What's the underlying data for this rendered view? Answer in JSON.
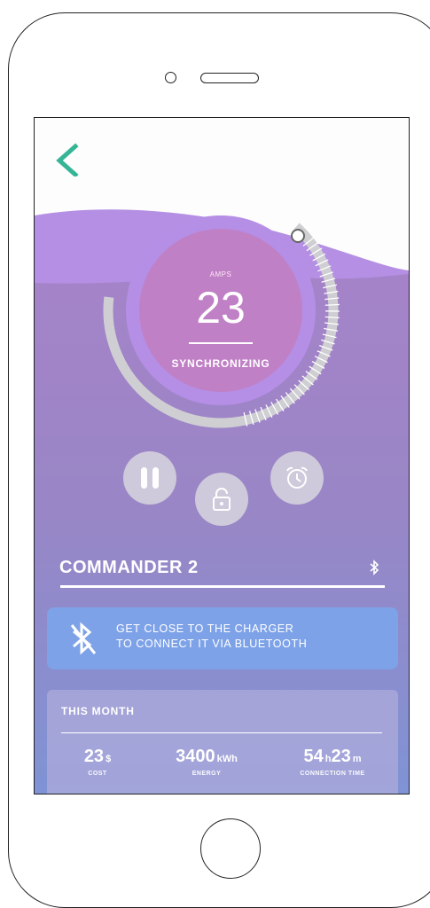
{
  "dial": {
    "amps_label": "AMPS",
    "amps_value": "23",
    "status": "SYNCHRONIZING"
  },
  "controls": {
    "pause": "pause-icon",
    "lock": "unlock-icon",
    "schedule": "alarm-clock-icon"
  },
  "device": {
    "name": "COMMANDER 2"
  },
  "notice": {
    "line1": "GET CLOSE TO THE CHARGER",
    "line2": "TO CONNECT IT VIA BLUETOOTH"
  },
  "month": {
    "title": "THIS MONTH",
    "cost": {
      "value": "23",
      "unit": "$",
      "label": "COST"
    },
    "energy": {
      "value": "3400",
      "unit": "kWh",
      "label": "ENERGY"
    },
    "time": {
      "hours": "54",
      "h_unit": "h",
      "minutes": "23",
      "m_unit": "m",
      "label": "CONNECTION TIME"
    }
  },
  "colors": {
    "accent": "#35b596",
    "purple_light": "#b58ee4",
    "purple_mid": "#9d84c8",
    "blue_bottom": "#7f93d4"
  }
}
